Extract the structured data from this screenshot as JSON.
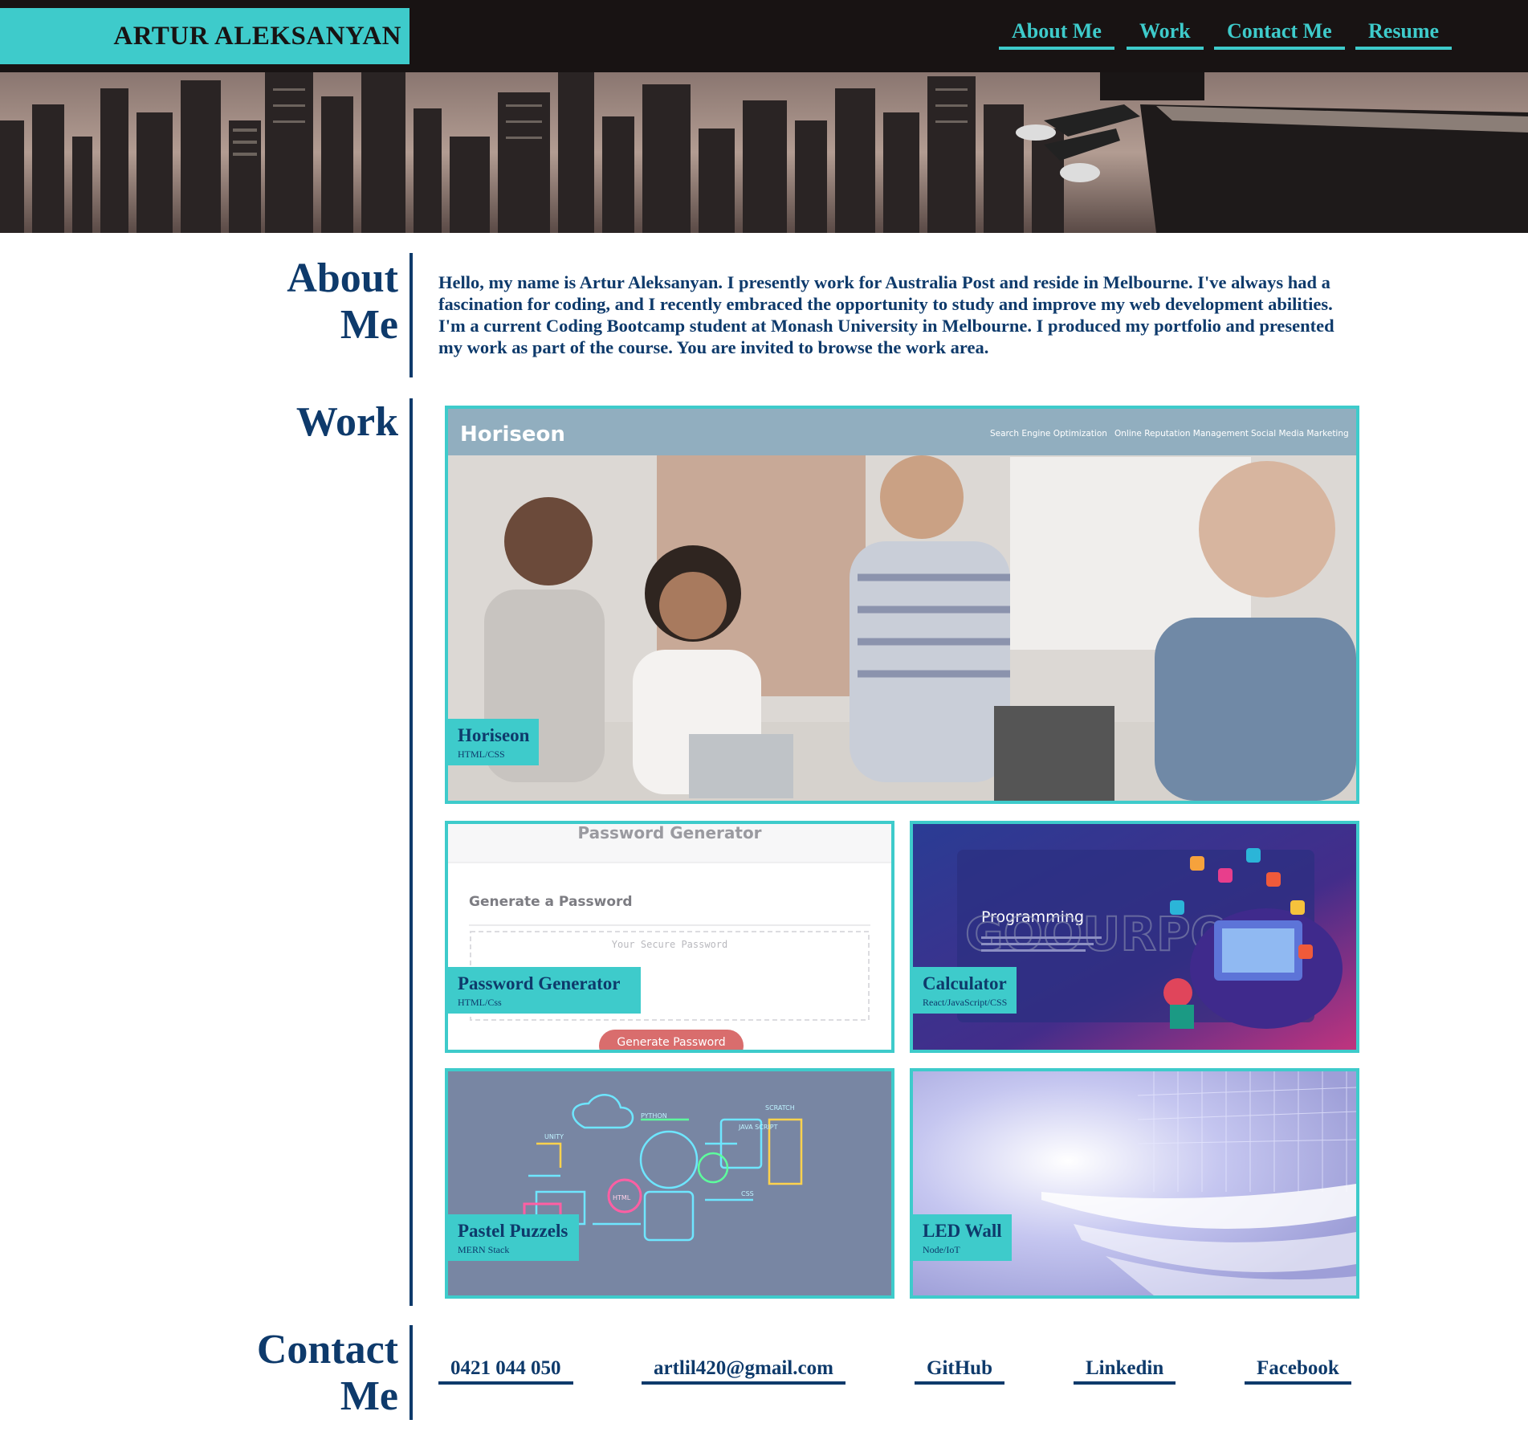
{
  "header": {
    "brand": "ARTUR ALEKSANYAN",
    "nav": [
      "About Me",
      "Work",
      "Contact Me",
      "Resume"
    ]
  },
  "about": {
    "title_line1": "About",
    "title_line2": "Me",
    "text": "Hello, my name is Artur Aleksanyan. I presently work for Australia Post and reside in Melbourne. I've always had a fascination for coding, and I recently embraced the opportunity to study and improve my web development abilities. I'm a current Coding Bootcamp student at Monash University in Melbourne. I produced my portfolio and presented my work as part of the course. You are invited to browse the work area."
  },
  "work": {
    "title": "Work",
    "projects": [
      {
        "title": "Horiseon",
        "tech": "HTML/CSS"
      },
      {
        "title": "Password Generator",
        "tech": "HTML/Css"
      },
      {
        "title": "Calculator",
        "tech": "React/JavaScript/CSS"
      },
      {
        "title": "Pastel Puzzels",
        "tech": "MERN Stack"
      },
      {
        "title": "LED Wall",
        "tech": "Node/IoT"
      }
    ],
    "horiseon_preview": {
      "logo": "Horiseon",
      "nav": [
        "Search Engine Optimization",
        "Online Reputation Management",
        "Social Media Marketing"
      ]
    },
    "password_preview": {
      "header": "Password Generator",
      "heading": "Generate a Password",
      "placeholder": "Your Secure Password",
      "button": "Generate Password"
    },
    "calculator_preview": {
      "heading": "Programming",
      "watermark": "GOOURPO"
    },
    "puzzels_preview": {
      "labels": [
        "PYTHON",
        "SCRATCH",
        "UNITY",
        "JAVA SCRIPT",
        "HTML",
        "CSS"
      ]
    }
  },
  "contact": {
    "title_line1": "Contact",
    "title_line2": "Me",
    "links": [
      "0421 044 050",
      "artlil420@gmail.com",
      "GitHub",
      "Linkedin",
      "Facebook"
    ]
  },
  "colors": {
    "accent": "#3ecbcb",
    "navy": "#0e3a6b",
    "header_bg": "#181313"
  }
}
